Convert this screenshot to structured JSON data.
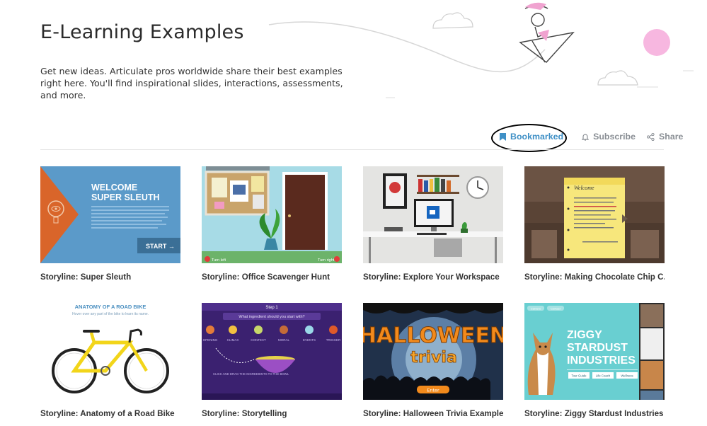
{
  "page": {
    "title": "E-Learning Examples",
    "intro": "Get new ideas. Articulate pros worldwide share their best examples right here. You'll find inspirational slides, interactions, assessments, and more."
  },
  "actions": {
    "bookmark_label": "Bookmarked",
    "subscribe_label": "Subscribe",
    "share_label": "Share"
  },
  "cards": [
    {
      "title": "Storyline: Super Sleuth",
      "thumb": {
        "heading1": "WELCOME",
        "heading2": "SUPER SLEUTH",
        "body": "Over the past several weeks several fraudulent checks have been cashed in our area. You are going to review several checks to determine if you would complete the transaction.",
        "button": "START →"
      }
    },
    {
      "title": "Storyline: Office Scavenger Hunt",
      "thumb": {
        "left": "Turn left",
        "right": "Turn right"
      }
    },
    {
      "title": "Storyline: Explore Your Workspace",
      "thumb": {}
    },
    {
      "title": "Storyline: Making Chocolate Chip C...",
      "thumb": {
        "note_title": "Welcome",
        "note_body": "In this course you will learn the essentials of baking \"Chocolate chip cookies\". Further more, this course will also provide you with a perfect environment for you to put this concepts into practice."
      }
    },
    {
      "title": "Storyline: Anatomy of a Road Bike",
      "thumb": {
        "heading": "ANATOMY OF A ROAD BIKE",
        "sub": "Hover over any part of the bike to learn its name."
      }
    },
    {
      "title": "Storyline: Storytelling",
      "thumb": {
        "step": "Step 1",
        "question": "What ingredient should you start with?",
        "labels": [
          "OPENING",
          "CLIMAX",
          "CONTEXT",
          "MORAL",
          "EVENTS",
          "TRIGGER"
        ],
        "hint": "CLICK AND DRAG THE INGREDIENTS TO THE BOWL"
      }
    },
    {
      "title": "Storyline: Halloween Trivia Example",
      "thumb": {
        "word1": "HALLOWEEN",
        "word2": "trivia",
        "button": "Enter"
      }
    },
    {
      "title": "Storyline: Ziggy Stardust Industries",
      "thumb": {
        "tabs": [
          "Careers",
          "Contact"
        ],
        "line1": "ZIGGY",
        "line2": "STARDUST",
        "line3": "INDUSTRIES",
        "buttons": [
          "Tour Guide",
          "Life Coach",
          "Wellness"
        ]
      }
    }
  ],
  "colors": {
    "accent": "#3f90c6",
    "muted": "#8a8f95",
    "pink": "#f5b6dd"
  }
}
